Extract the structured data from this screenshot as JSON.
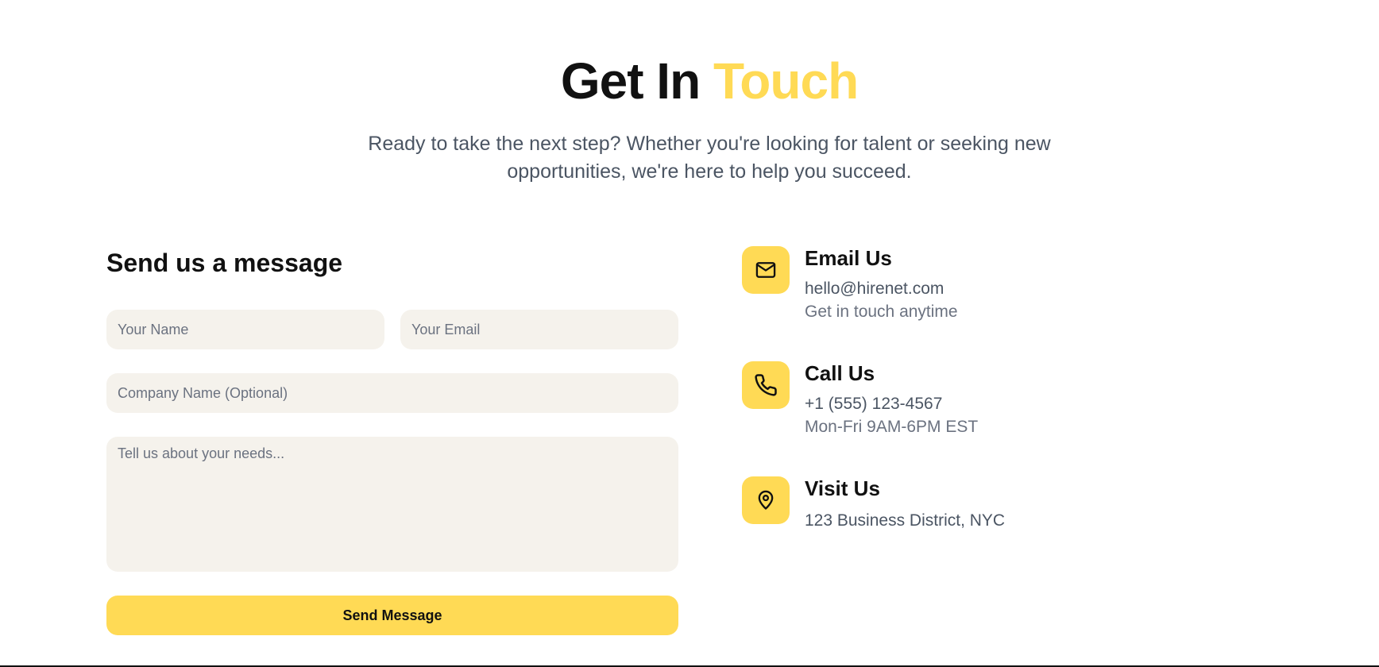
{
  "hero": {
    "title_part1": "Get In ",
    "title_part2": "Touch",
    "subtitle": "Ready to take the next step? Whether you're looking for talent or seeking new opportunities, we're here to help you succeed."
  },
  "form": {
    "title": "Send us a message",
    "name_placeholder": "Your Name",
    "email_placeholder": "Your Email",
    "company_placeholder": "Company Name (Optional)",
    "message_placeholder": "Tell us about your needs...",
    "submit_label": "Send Message"
  },
  "contact": {
    "email": {
      "icon": "mail-icon",
      "title": "Email Us",
      "value": "hello@hirenet.com",
      "note": "Get in touch anytime"
    },
    "phone": {
      "icon": "phone-icon",
      "title": "Call Us",
      "value": "+1 (555) 123-4567",
      "note": "Mon-Fri 9AM-6PM EST"
    },
    "visit": {
      "icon": "map-pin-icon",
      "title": "Visit Us",
      "value": "123 Business District, NYC"
    }
  },
  "colors": {
    "accent": "#ffda55",
    "input_background": "#f5f2ec",
    "text_primary": "#111111",
    "text_secondary": "#4b5563"
  }
}
